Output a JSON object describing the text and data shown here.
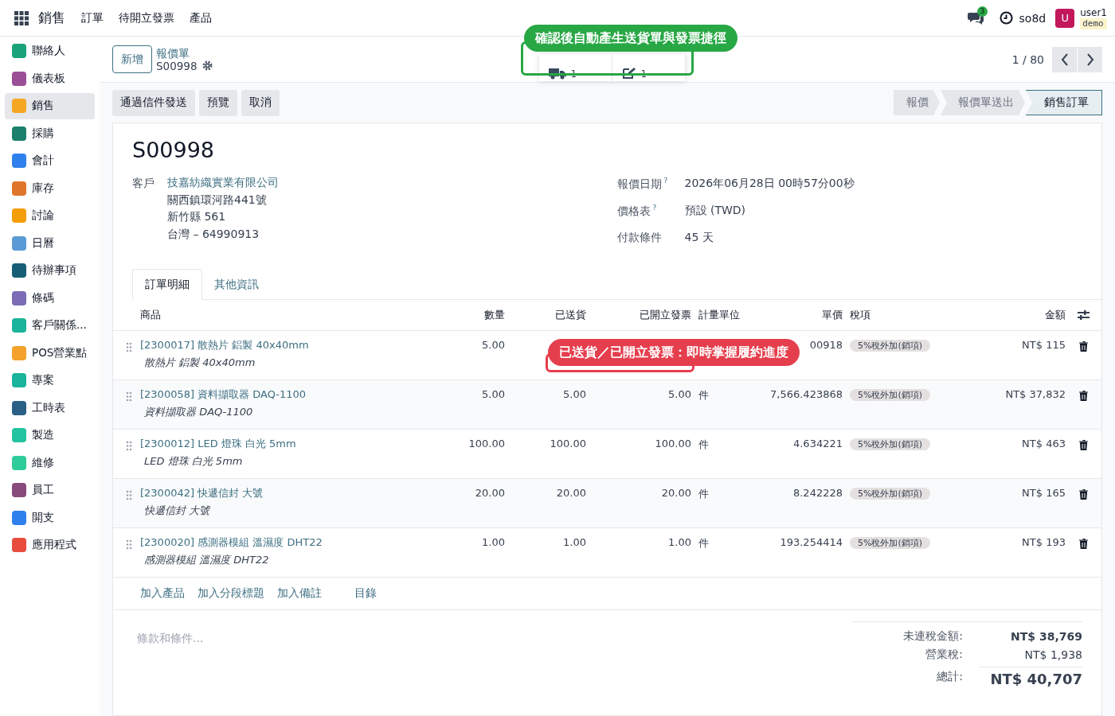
{
  "top_nav": {
    "app": "銷售",
    "menus": [
      "訂單",
      "待開立發票",
      "產品"
    ],
    "chat_count": "3",
    "company": "so8d",
    "avatar": "U",
    "user": "user1",
    "database": "demo"
  },
  "sidebar": {
    "items": [
      {
        "label": "聯絡人",
        "color": "#1aa37a",
        "selected": false
      },
      {
        "label": "儀表板",
        "color": "#9b4f96",
        "selected": false
      },
      {
        "label": "銷售",
        "color": "#f5a623",
        "selected": true
      },
      {
        "label": "採購",
        "color": "#1b7f6b",
        "selected": false
      },
      {
        "label": "會計",
        "color": "#2f80ed",
        "selected": false
      },
      {
        "label": "庫存",
        "color": "#e0762c",
        "selected": false
      },
      {
        "label": "討論",
        "color": "#f59e0b",
        "selected": false
      },
      {
        "label": "日曆",
        "color": "#5b9bd5",
        "selected": false
      },
      {
        "label": "待辦事項",
        "color": "#155e75",
        "selected": false
      },
      {
        "label": "條碼",
        "color": "#7c6bb5",
        "selected": false
      },
      {
        "label": "客戶關係...",
        "color": "#1ab39b",
        "selected": false
      },
      {
        "label": "POS營業點",
        "color": "#f4a22b",
        "selected": false
      },
      {
        "label": "專案",
        "color": "#1ab39b",
        "selected": false
      },
      {
        "label": "工時表",
        "color": "#2a5f86",
        "selected": false
      },
      {
        "label": "製造",
        "color": "#21c3a0",
        "selected": false
      },
      {
        "label": "維修",
        "color": "#2ecc9a",
        "selected": false
      },
      {
        "label": "員工",
        "color": "#874a7a",
        "selected": false
      },
      {
        "label": "開支",
        "color": "#2f80ed",
        "selected": false
      },
      {
        "label": "應用程式",
        "color": "#e74c3c",
        "selected": false
      }
    ]
  },
  "control_panel": {
    "new_button": "新增",
    "breadcrumb": "報價單",
    "record": "S00998",
    "smart_buttons": [
      {
        "kind": "delivery",
        "count": "1"
      },
      {
        "kind": "invoice",
        "count": "1"
      }
    ],
    "pager": "1 / 80"
  },
  "actions": [
    "通過信件發送",
    "預覽",
    "取消"
  ],
  "statusbar": [
    {
      "label": "報價",
      "selected": false
    },
    {
      "label": "報價單送出",
      "selected": false
    },
    {
      "label": "銷售訂單",
      "selected": true
    }
  ],
  "form": {
    "title": "S00998",
    "customer_label": "客戶",
    "customer": "技嘉紡織實業有限公司",
    "address": [
      "關西鎮環河路441號",
      "新竹縣 561",
      "台灣 – 64990913"
    ],
    "fields": [
      {
        "label": "報價日期",
        "help": "?",
        "value": "2026年06月28日 00時57分00秒"
      },
      {
        "label": "價格表",
        "help": "?",
        "value": "預設 (TWD)"
      },
      {
        "label": "付款條件",
        "value": "45 天"
      }
    ]
  },
  "tabs": [
    {
      "label": "訂單明細",
      "selected": true
    },
    {
      "label": "其他資訊",
      "selected": false
    }
  ],
  "table": {
    "columns": [
      "商品",
      "數量",
      "已送貨",
      "已開立發票",
      "計量單位",
      "單價",
      "稅項",
      "金額"
    ],
    "rows": [
      {
        "product": "[2300017] 散熱片 鋁製 40x40mm",
        "description": "散熱片 鋁製 40x40mm",
        "quantity": "5.00",
        "price": "00918",
        "tax": "5%稅外加(銷項)",
        "amount": "NT$ 115"
      },
      {
        "product": "[2300058] 資料擷取器 DAQ-1100",
        "description": "資料擷取器 DAQ-1100",
        "quantity": "5.00",
        "delivered": "5.00",
        "invoiced": "5.00",
        "unit": "件",
        "price": "7,566.423868",
        "tax": "5%稅外加(銷項)",
        "amount": "NT$ 37,832"
      },
      {
        "product": "[2300012] LED 燈珠 白光 5mm",
        "description": "LED 燈珠 白光 5mm",
        "quantity": "100.00",
        "delivered": "100.00",
        "invoiced": "100.00",
        "unit": "件",
        "price": "4.634221",
        "tax": "5%稅外加(銷項)",
        "amount": "NT$ 463"
      },
      {
        "product": "[2300042] 快遞信封 大號",
        "description": "快遞信封 大號",
        "quantity": "20.00",
        "delivered": "20.00",
        "invoiced": "20.00",
        "unit": "件",
        "price": "8.242228",
        "tax": "5%稅外加(銷項)",
        "amount": "NT$ 165"
      },
      {
        "product": "[2300020] 感測器模組 溫濕度 DHT22",
        "description": "感測器模組 溫濕度 DHT22",
        "quantity": "1.00",
        "delivered": "1.00",
        "invoiced": "1.00",
        "unit": "件",
        "price": "193.254414",
        "tax": "5%稅外加(銷項)",
        "amount": "NT$ 193"
      }
    ],
    "add_links": [
      "加入產品",
      "加入分段標題",
      "加入備註",
      "目錄"
    ]
  },
  "terms": {
    "placeholder": "條款和條件..."
  },
  "totals": [
    {
      "label": "未連稅金額:",
      "value": "NT$ 38,769",
      "kind": "bold"
    },
    {
      "label": "營業稅:",
      "value": "NT$ 1,938",
      "kind": "plain"
    },
    {
      "label": "總計:",
      "value": "NT$ 40,707",
      "kind": "grand"
    }
  ],
  "callouts": [
    {
      "kind": "green",
      "text": "確認後自動產生送貨單與發票捷徑"
    },
    {
      "kind": "red",
      "text": "已送貨／已開立發票：即時掌握履約進度"
    }
  ]
}
